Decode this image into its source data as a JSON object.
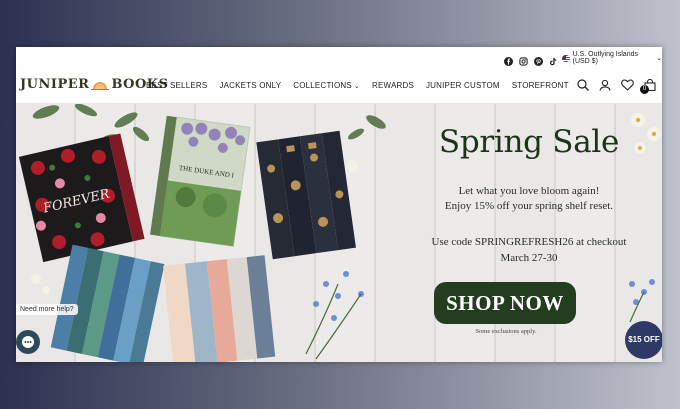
{
  "topbar": {
    "social_icons": [
      "facebook-icon",
      "instagram-icon",
      "pinterest-icon",
      "tiktok-icon"
    ],
    "region": "U.S. Outlying Islands (USD $)"
  },
  "nav": {
    "logo_left": "JUNIPER",
    "logo_right": "BOOKS",
    "links": [
      "BEST SELLERS",
      "JACKETS ONLY",
      "COLLECTIONS",
      "REWARDS",
      "JUNIPER CUSTOM",
      "STOREFRONT"
    ],
    "cart_count": "0"
  },
  "hero": {
    "book_titles": [
      "FOREVER",
      "THE DUKE AND I"
    ],
    "headline": "Spring Sale",
    "line1": "Let what you love bloom again!",
    "line2": "Enjoy 15% off your spring shelf reset.",
    "line3": "Use code SPRINGREFRESH26 at checkout",
    "line4": "March 27-30",
    "cta": "SHOP NOW",
    "note": "Some exclusions apply."
  },
  "widgets": {
    "help": "Need more help?",
    "discount": "$15 OFF"
  },
  "colors": {
    "brand_green": "#233d1f",
    "discount_blue": "#2e3966"
  }
}
